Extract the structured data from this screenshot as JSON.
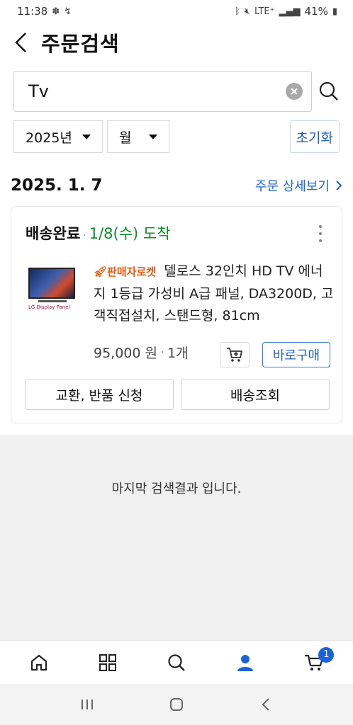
{
  "status_bar": {
    "time": "11:38",
    "network": "LTE⁺",
    "battery": "41%"
  },
  "header": {
    "title": "주문검색"
  },
  "search": {
    "value": "Tv"
  },
  "filters": {
    "year": "2025년",
    "month": "월",
    "reset_label": "초기화"
  },
  "order": {
    "date": "2025. 1. 7",
    "detail_link": "주문 상세보기",
    "status": "배송완료",
    "arrival": "1/8(수) 도착",
    "product": {
      "badge": "판매자로켓",
      "name": "델로스 32인치 HD TV 에너지 1등급 가성비 A급 패널, DA3200D, 고객직접설치, 스탠드형, 81cm",
      "thumb_brand": "LG Display Panel",
      "price": "95,000 원",
      "quantity": "1개"
    },
    "buy_label": "바로구매",
    "actions": [
      "교환, 반품 신청",
      "배송조회"
    ]
  },
  "end_message": "마지막 검색결과 입니다.",
  "bottom_nav": {
    "cart_count": "1",
    "active": "my-page"
  },
  "colors": {
    "accent": "#1d5fc8",
    "arrival_green": "#0b8a2a",
    "rocket_orange": "#e8590c"
  }
}
